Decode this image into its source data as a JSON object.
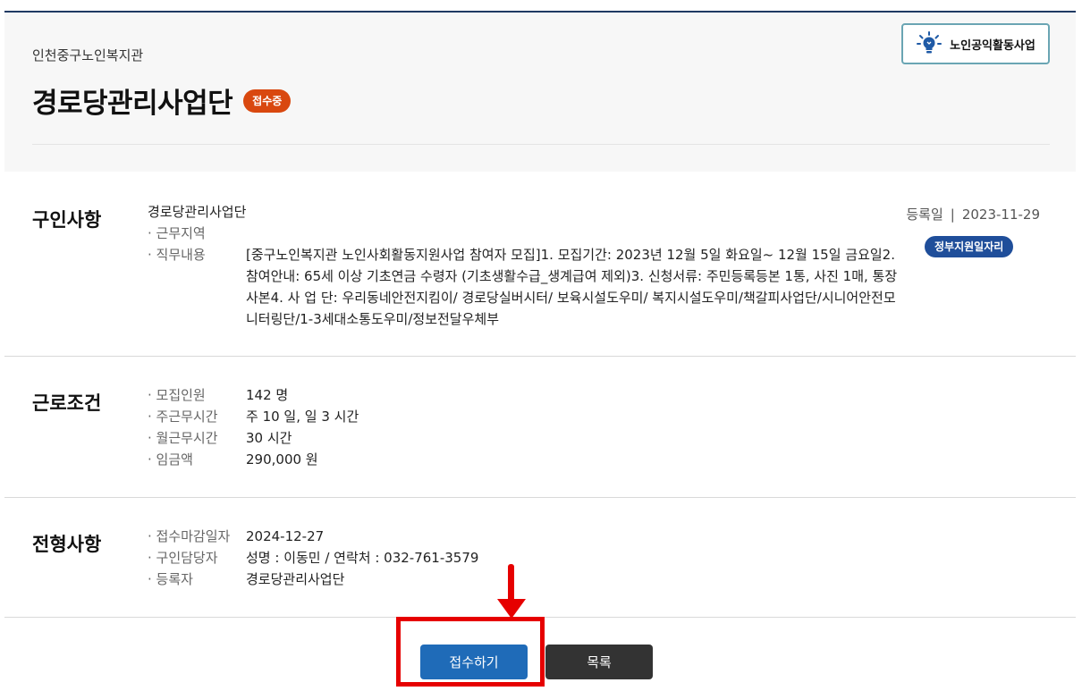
{
  "header": {
    "organization": "인천중구노인복지관",
    "title": "경로당관리사업단",
    "status_badge": "접수중",
    "program_label": "노인공익활동사업"
  },
  "job_info": {
    "section_title": "구인사항",
    "company": "경로당관리사업단",
    "work_area_label": "· 근무지역",
    "work_area_value": "",
    "duty_label": "· 직무내용",
    "duty_value": "[중구노인복지관 노인사회활동지원사업 참여자 모집]1. 모집기간: 2023년 12월 5일 화요일~ 12월 15일 금요일2. 참여안내: 65세 이상 기초연금 수령자 (기초생활수급_생계급여 제외)3. 신청서류: 주민등록등본 1통, 사진 1매, 통장사본4. 사 업 단: 우리동네안전지킴이/ 경로당실버시터/ 보육시설도우미/ 복지시설도우미/책갈피사업단/시니어안전모니터링단/1-3세대소통도우미/정보전달우체부",
    "reg_label": "등록일",
    "reg_sep": "|",
    "reg_date": "2023-11-29",
    "gov_badge": "정부지원일자리"
  },
  "conditions": {
    "section_title": "근로조건",
    "rows": [
      {
        "label": "· 모집인원",
        "value": "142 명"
      },
      {
        "label": "· 주근무시간",
        "value": "주 10 일, 일 3 시간"
      },
      {
        "label": "· 월근무시간",
        "value": "30 시간"
      },
      {
        "label": "· 임금액",
        "value": "290,000 원"
      }
    ]
  },
  "selection": {
    "section_title": "전형사항",
    "rows": [
      {
        "label": "· 접수마감일자",
        "value": "2024-12-27"
      },
      {
        "label": "· 구인담당자",
        "value": "성명 : 이동민 / 연락처 : 032-761-3579"
      },
      {
        "label": "· 등록자",
        "value": "경로당관리사업단"
      }
    ]
  },
  "actions": {
    "apply_label": "접수하기",
    "list_label": "목록"
  },
  "colors": {
    "status_badge": "#d9480f",
    "gov_badge": "#1f4e9a",
    "apply_button": "#1f6bb8",
    "list_button": "#333333",
    "annotation": "#e60000"
  },
  "icons": {
    "program": "lightbulb-icon"
  }
}
